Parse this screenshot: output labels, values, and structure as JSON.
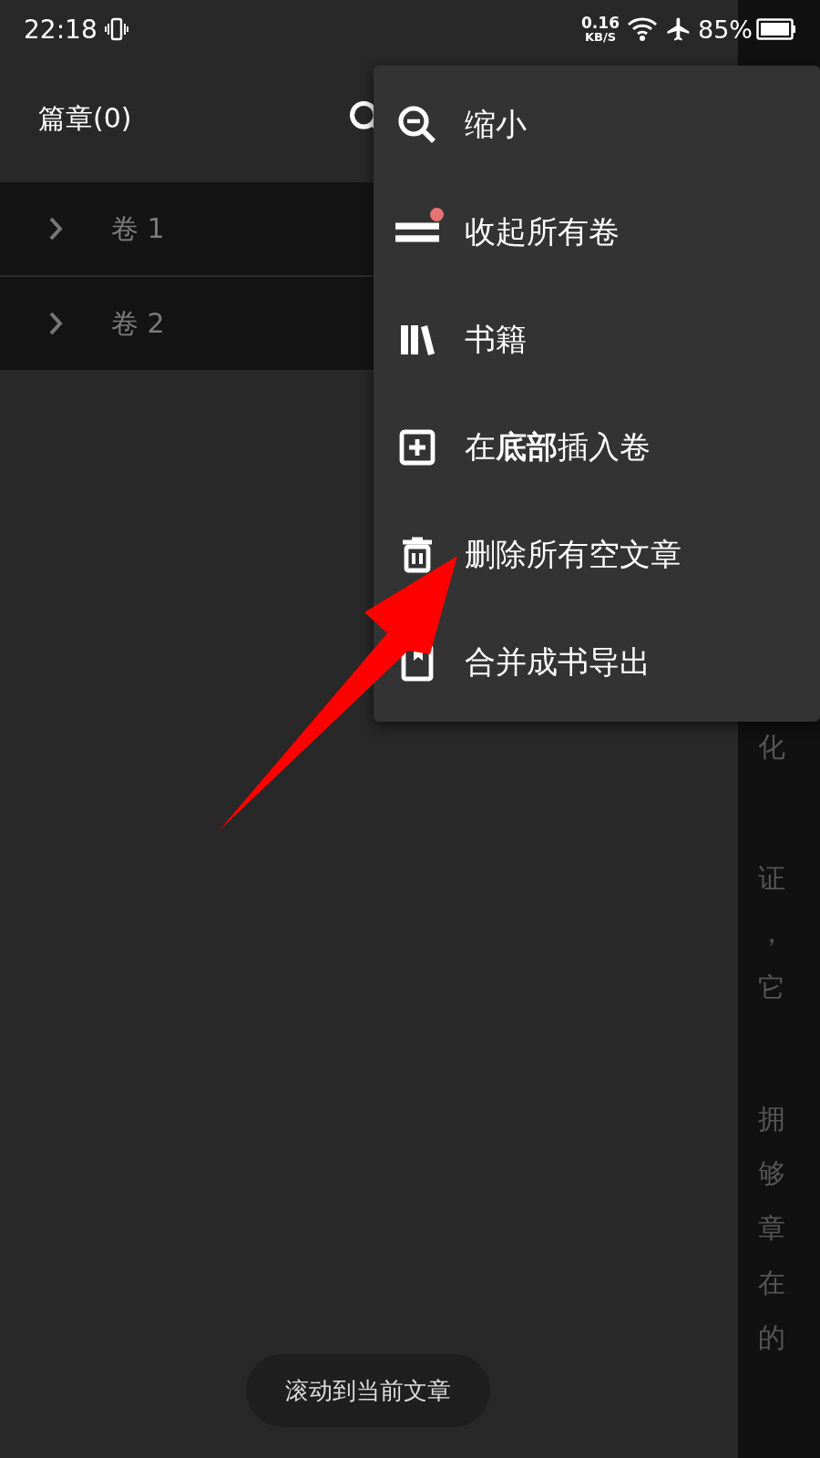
{
  "status_bar": {
    "time": "22:18",
    "net_speed": "0.16",
    "net_unit": "KB/S",
    "battery": "85%"
  },
  "drawer": {
    "title": "篇章(0)",
    "volumes": [
      {
        "label": "卷 1",
        "expanded": false
      },
      {
        "label": "卷 2",
        "expanded": false
      }
    ]
  },
  "background_text": [
    [
      "化"
    ],
    [
      "证",
      "，",
      "它"
    ],
    [
      "拥",
      "够",
      "章",
      "在",
      "的"
    ]
  ],
  "menu": [
    {
      "label": "缩小",
      "dot": false
    },
    {
      "label": "收起所有卷",
      "dot": true
    },
    {
      "label": "书籍",
      "dot": false
    },
    {
      "label": "在**底部**插入卷",
      "dot": false
    },
    {
      "label": "删除所有空文章",
      "dot": false
    },
    {
      "label": "合并成书导出",
      "dot": false
    }
  ],
  "toast": "滚动到当前文章",
  "annotation": {
    "kind": "arrow"
  }
}
